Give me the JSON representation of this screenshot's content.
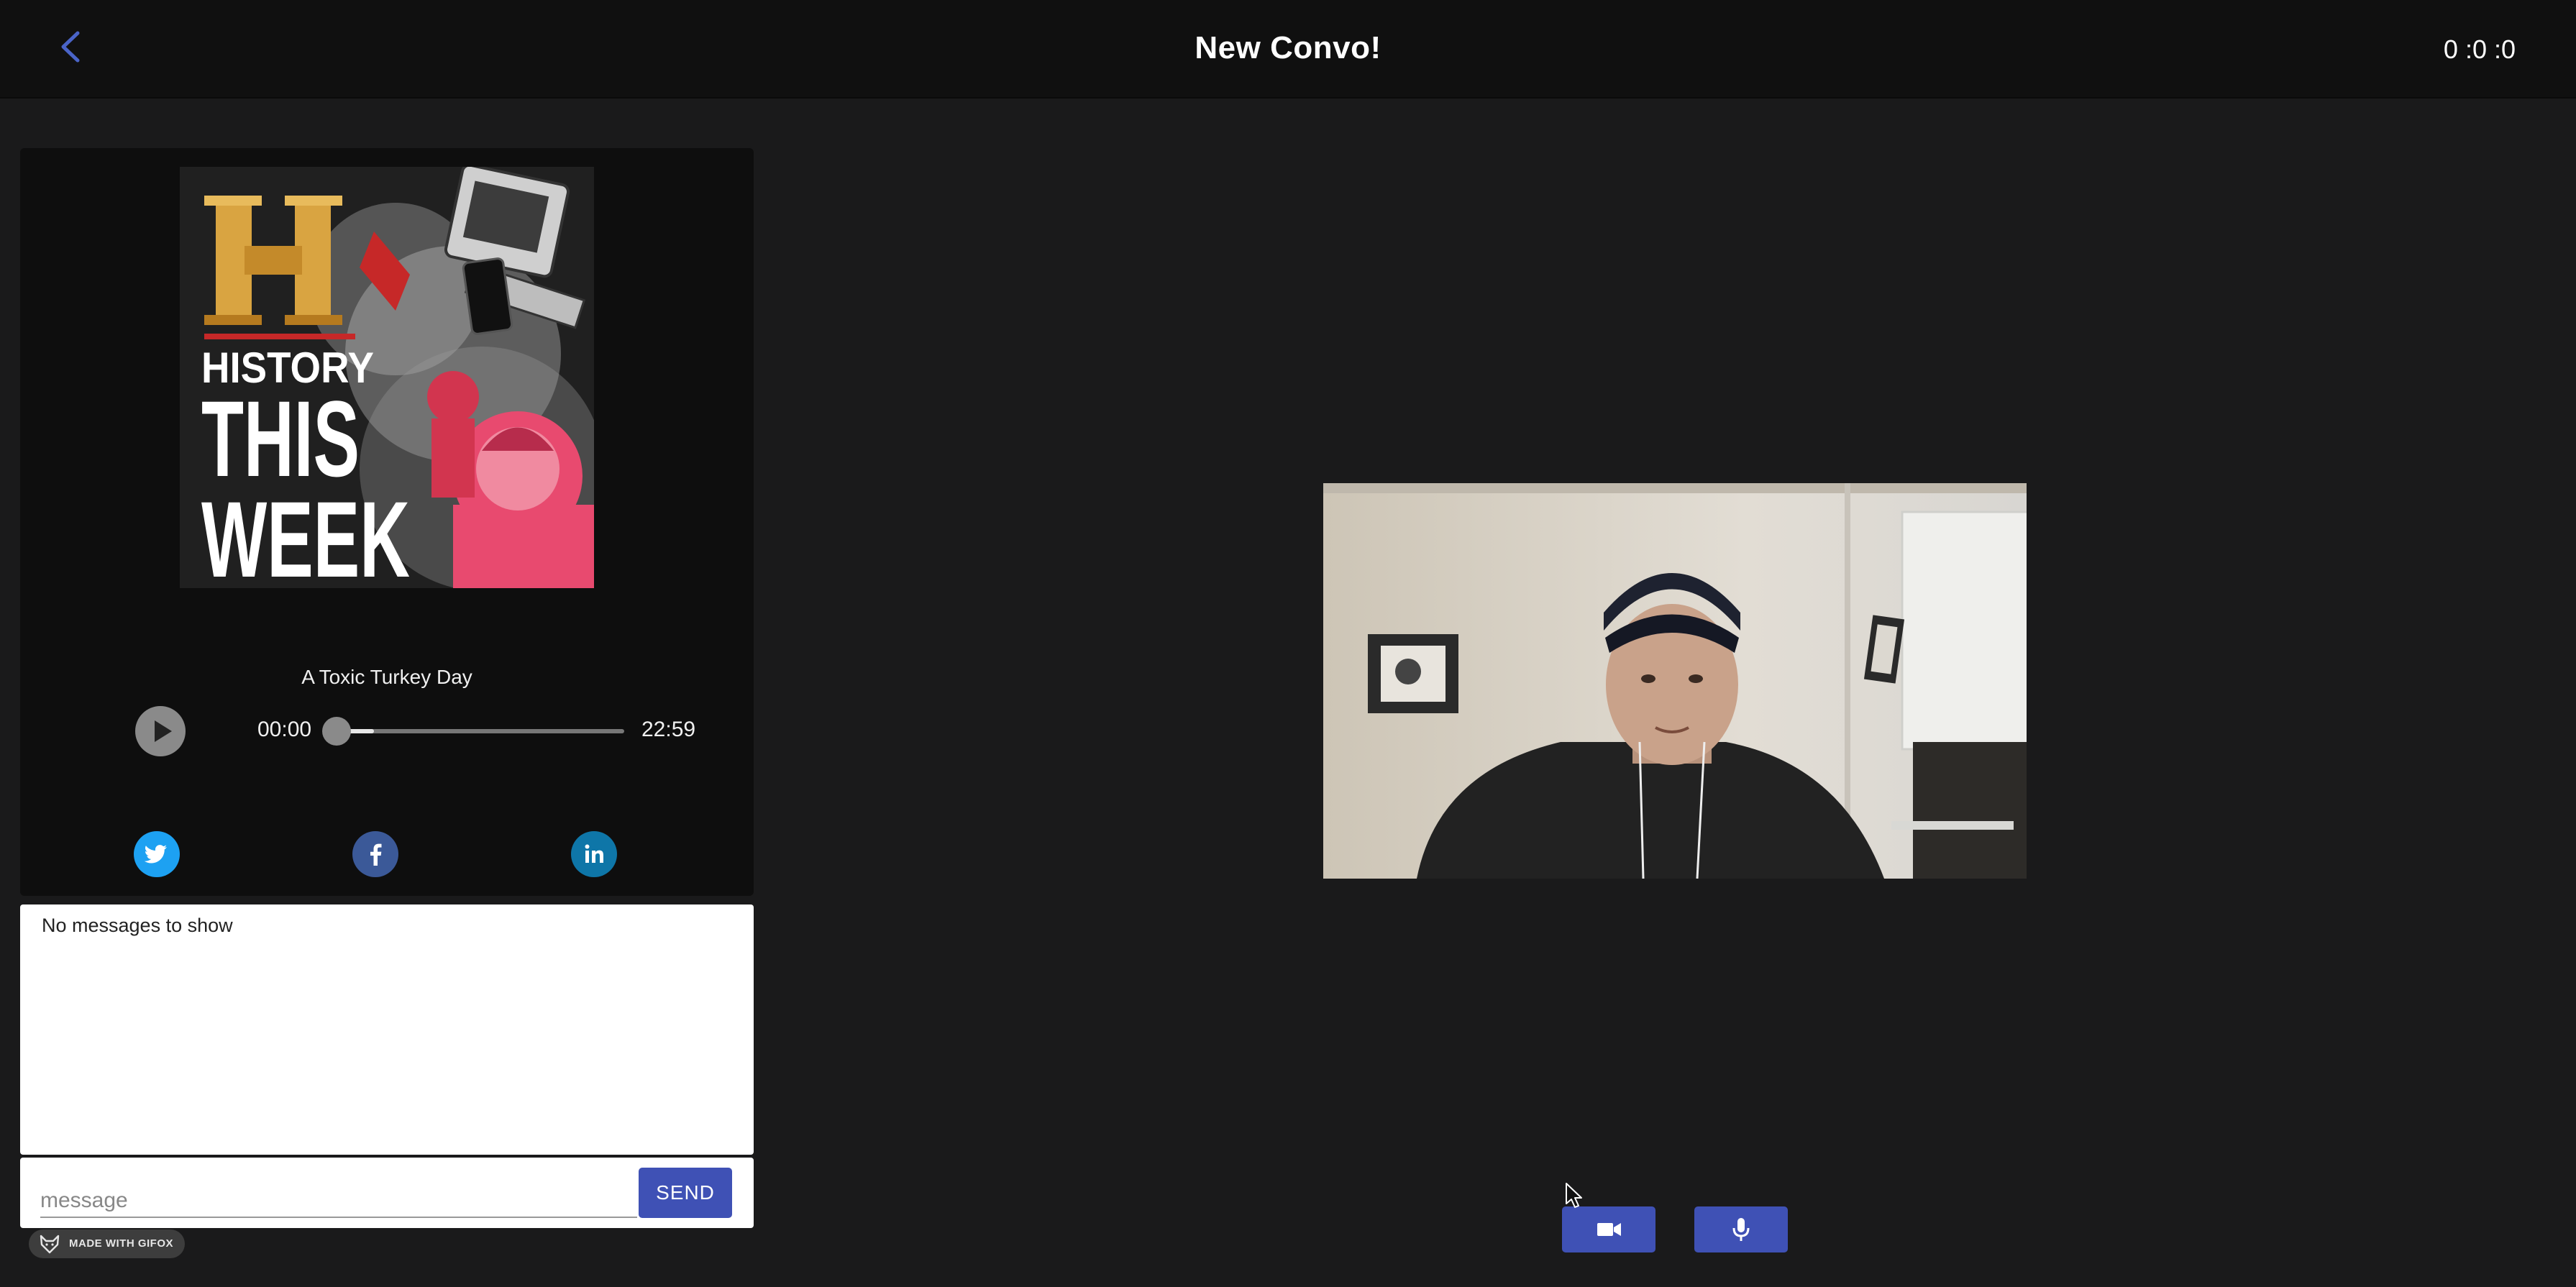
{
  "header": {
    "back_icon": "chevron-left-icon",
    "title": "New Convo!",
    "timer": "0 :0 :0"
  },
  "podcast": {
    "cover_lines": [
      "HISTORY",
      "THIS",
      "WEEK"
    ],
    "episode_title": "A Toxic Turkey Day",
    "current_time": "00:00",
    "duration": "22:59",
    "buffered_fraction": 0.13,
    "progress_fraction": 0.0
  },
  "share": {
    "items": [
      {
        "name": "twitter",
        "icon": "twitter-icon",
        "color": "#1da1f2"
      },
      {
        "name": "facebook",
        "icon": "facebook-icon",
        "color": "#3b5998"
      },
      {
        "name": "linkedin",
        "icon": "linkedin-icon",
        "color": "#0e76a8"
      }
    ]
  },
  "chat": {
    "empty_text": "No messages to show",
    "input_placeholder": "message",
    "send_label": "SEND"
  },
  "badge": {
    "text": "MADE WITH GIFOX"
  },
  "controls": {
    "video_icon": "video-camera-icon",
    "mic_icon": "microphone-icon",
    "accent": "#3f51b5"
  }
}
